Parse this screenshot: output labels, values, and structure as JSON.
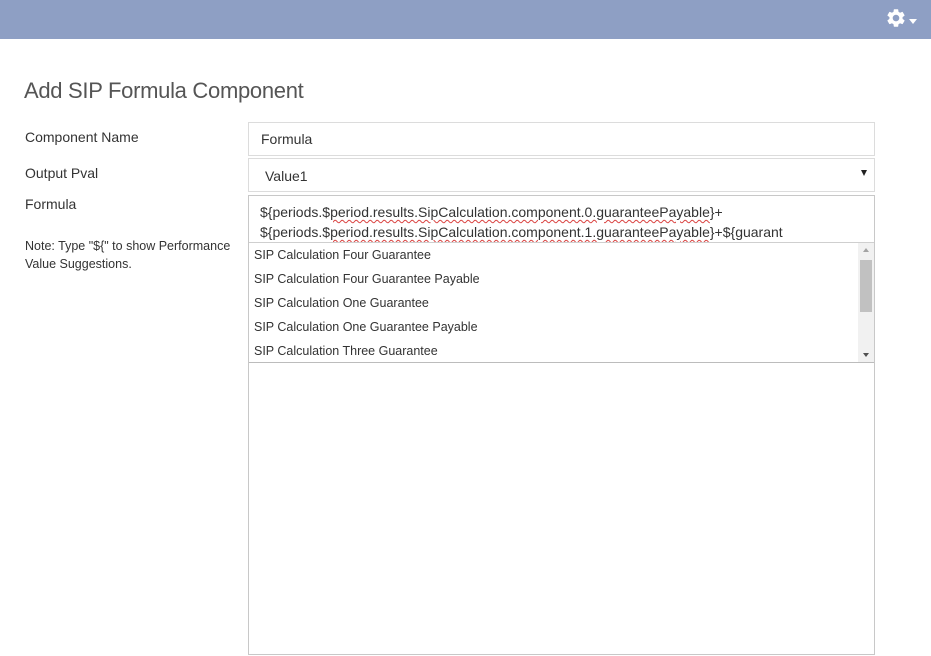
{
  "header": {
    "settings_icon": "gear-icon",
    "settings_menu_icon": "caret-down-icon",
    "bar_color": "#8e9fc4"
  },
  "page": {
    "title": "Add SIP Formula Component"
  },
  "form": {
    "component_name_label": "Component Name",
    "component_name_value": "Formula",
    "output_pval_label": "Output Pval",
    "output_pval_selected": "Value1",
    "formula_label": "Formula",
    "note": "Note: Type \"${\" to show Performance Value Suggestions.",
    "formula_line1": {
      "pre": "${periods.$",
      "squiggle": "period.results.SipCalculation.component.0.guaranteePayable",
      "post": "}+"
    },
    "formula_line2": {
      "pre": "${periods.$",
      "squiggle": "period.results.SipCalculation.component.1.guaranteePayable",
      "post": "}+${guarant"
    }
  },
  "suggestions": [
    "SIP Calculation Four Guarantee",
    "SIP Calculation Four Guarantee Payable",
    "SIP Calculation One Guarantee",
    "SIP Calculation One Guarantee Payable",
    "SIP Calculation Three Guarantee"
  ]
}
